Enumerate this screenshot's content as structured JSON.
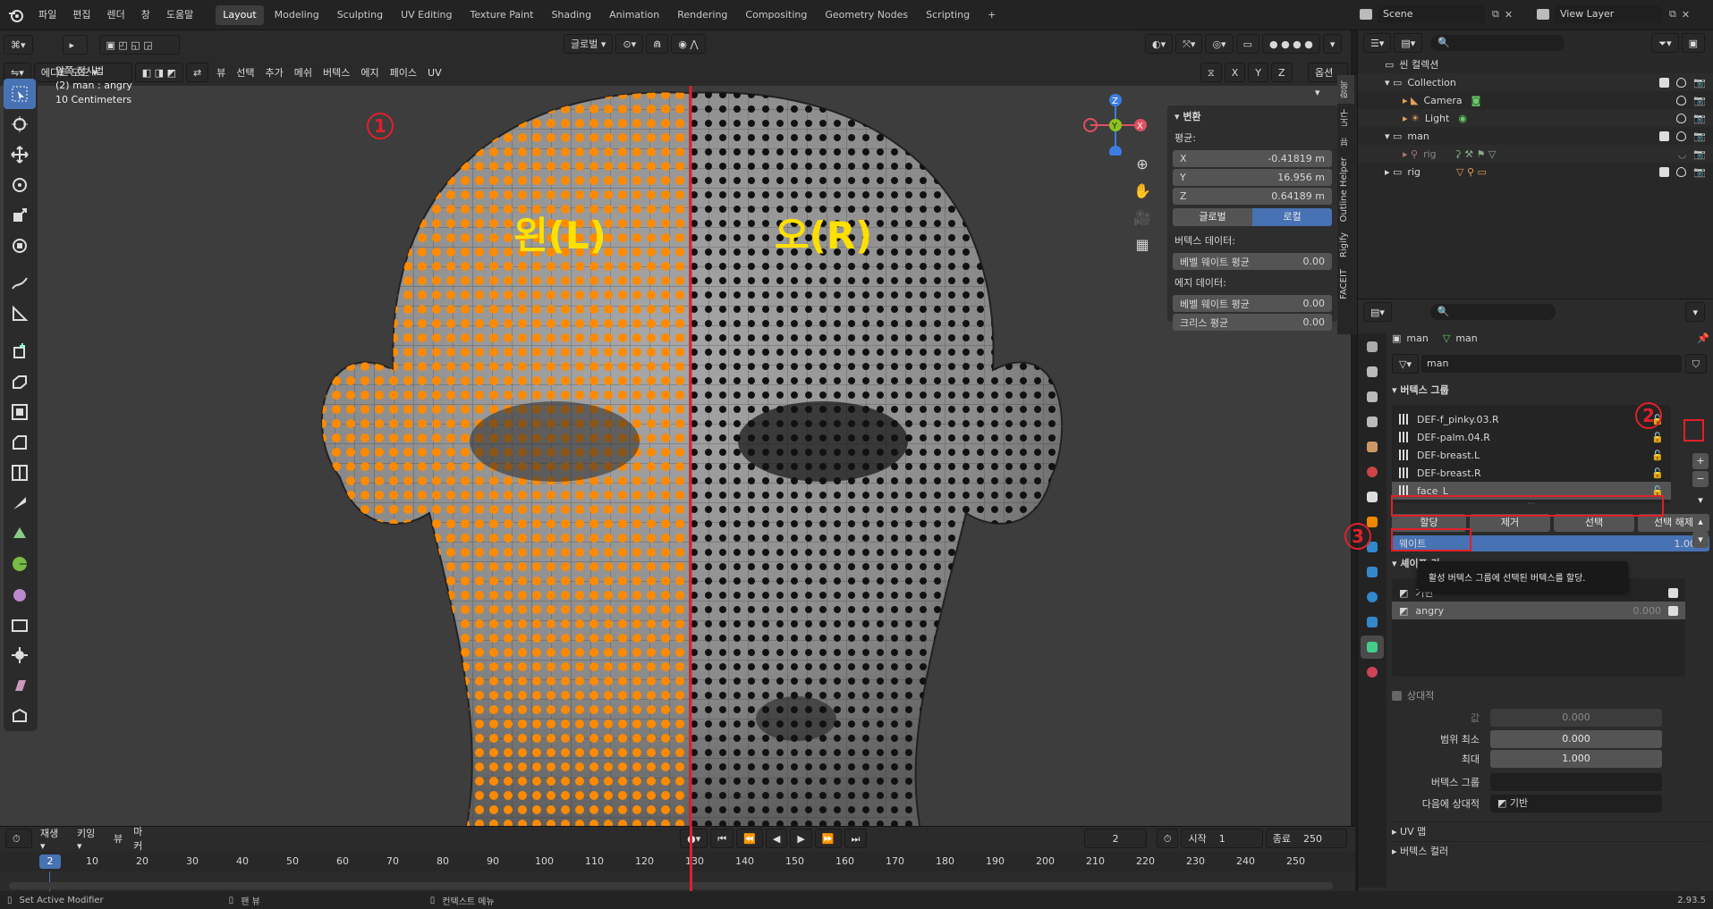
{
  "menu": [
    "파일",
    "편집",
    "렌더",
    "창",
    "도움말"
  ],
  "workspaces": [
    "Layout",
    "Modeling",
    "Sculpting",
    "UV Editing",
    "Texture Paint",
    "Shading",
    "Animation",
    "Rendering",
    "Compositing",
    "Geometry Nodes",
    "Scripting"
  ],
  "active_workspace": "Layout",
  "add_tab": "+",
  "scene": {
    "name": "Scene",
    "view_layer": "View Layer"
  },
  "viewport": {
    "mode": "에디트 모드",
    "header_menus": [
      "뷰",
      "선택",
      "추가",
      "메쉬",
      "버텍스",
      "에지",
      "페이스",
      "UV"
    ],
    "transform_orientation": "글로벌",
    "options": "옵션",
    "axes": [
      "X",
      "Y",
      "Z"
    ],
    "info_line1": "앞쪽 정사법",
    "info_line2": "(2) man : angry",
    "info_line3": "10 Centimeters",
    "label_left": "왼(L)",
    "label_right": "오(R)",
    "label_left_color": "#ffe000",
    "label_right_color": "#ffe000",
    "selected_color": "#ff8000"
  },
  "npanel": {
    "section": "변환",
    "median": "평균:",
    "x_label": "X",
    "x_value": "-0.41819 m",
    "y_label": "Y",
    "y_value": "16.956 m",
    "z_label": "Z",
    "z_value": "0.64189 m",
    "global": "글로벌",
    "local": "로컬",
    "vertex_data": "버텍스 데이터:",
    "vertex_bevel": "베벨 웨이트 평균",
    "vertex_bevel_val": "0.00",
    "edge_data": "에지 데이터:",
    "edge_bevel": "베벨 웨이트 평균",
    "edge_bevel_val": "0.00",
    "crease": "크리스 평균",
    "crease_val": "0.00"
  },
  "side_tabs": [
    "항목",
    "도구",
    "뷰",
    "Outline Helper",
    "Rigify",
    "FACEIT"
  ],
  "outliner": {
    "root": "씬 컬렉션",
    "items": [
      {
        "name": "Collection",
        "level": 1
      },
      {
        "name": "Camera",
        "level": 2
      },
      {
        "name": "Light",
        "level": 2
      },
      {
        "name": "man",
        "level": 1
      },
      {
        "name": "rig",
        "level": 2
      },
      {
        "name": "rig",
        "level": 1
      }
    ]
  },
  "properties": {
    "breadcrumb_obj": "man",
    "breadcrumb_data": "man",
    "mesh_name": "man",
    "vertex_groups_title": "버텍스 그룹",
    "vertex_groups": [
      "DEF-f_pinky.03.R",
      "DEF-palm.04.R",
      "DEF-breast.L",
      "DEF-breast.R",
      "face_L"
    ],
    "active_group": "face_L",
    "assign": "할당",
    "remove": "제거",
    "select": "선택",
    "deselect": "선택 해제",
    "weight_label": "웨이트",
    "weight_value": "1.000",
    "tooltip": "활성 버텍스 그룹에 선택된 버텍스를 할당.",
    "shape_keys_title": "셰이프 키",
    "shape_keys": [
      {
        "name": "기반",
        "value": ""
      },
      {
        "name": "angry",
        "value": "0.000"
      }
    ],
    "relative": "상대적",
    "value_label": "값",
    "value_val": "0.000",
    "range_min_label": "범위 최소",
    "range_min_val": "0.000",
    "max_label": "최대",
    "max_val": "1.000",
    "vgroup_label": "버텍스 그룹",
    "relative_to_label": "다음에 상대적",
    "relative_to_val": "기반",
    "uv_maps": "UV 맵",
    "vertex_colors": "버텍스 컬러"
  },
  "timeline": {
    "playback": "재생",
    "keying": "키잉",
    "view": "뷰",
    "marker": "마커",
    "current_frame": "2",
    "start_label": "시작",
    "start": "1",
    "end_label": "종료",
    "end": "250",
    "ticks": [
      "2",
      "10",
      "20",
      "30",
      "40",
      "50",
      "60",
      "70",
      "80",
      "90",
      "100",
      "110",
      "120",
      "130",
      "140",
      "150",
      "160",
      "170",
      "180",
      "190",
      "200",
      "210",
      "220",
      "230",
      "240",
      "250"
    ]
  },
  "status": {
    "left": "Set Active Modifier",
    "mid1": "팬 뷰",
    "mid2": "컨텍스트 메뉴",
    "version": "2.93.5"
  },
  "annotations": [
    "1",
    "2",
    "3"
  ]
}
